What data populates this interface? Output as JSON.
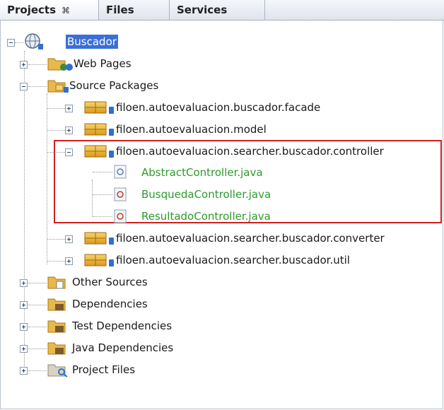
{
  "tabs": [
    {
      "label": "Projects",
      "close": "⌘",
      "active": true
    },
    {
      "label": "Files",
      "active": false
    },
    {
      "label": "Services",
      "active": false
    }
  ],
  "tree": {
    "root": "Buscador",
    "web_pages": "Web Pages",
    "source_packages": "Source Packages",
    "packages": [
      "filoen.autoevaluacion.buscador.facade",
      "filoen.autoevaluacion.model",
      "filoen.autoevaluacion.searcher.buscador.controller",
      "filoen.autoevaluacion.searcher.buscador.converter",
      "filoen.autoevaluacion.searcher.buscador.util"
    ],
    "controller_files": [
      "AbstractController.java",
      "BusquedaController.java",
      "ResultadoController.java"
    ],
    "other_sources": "Other Sources",
    "dependencies": "Dependencies",
    "test_dependencies": "Test Dependencies",
    "java_dependencies": "Java Dependencies",
    "project_files": "Project Files"
  },
  "colors": {
    "selection": "#3b6fd6",
    "changed_file_text": "#2d9a2d",
    "highlight_border": "#d02020"
  }
}
